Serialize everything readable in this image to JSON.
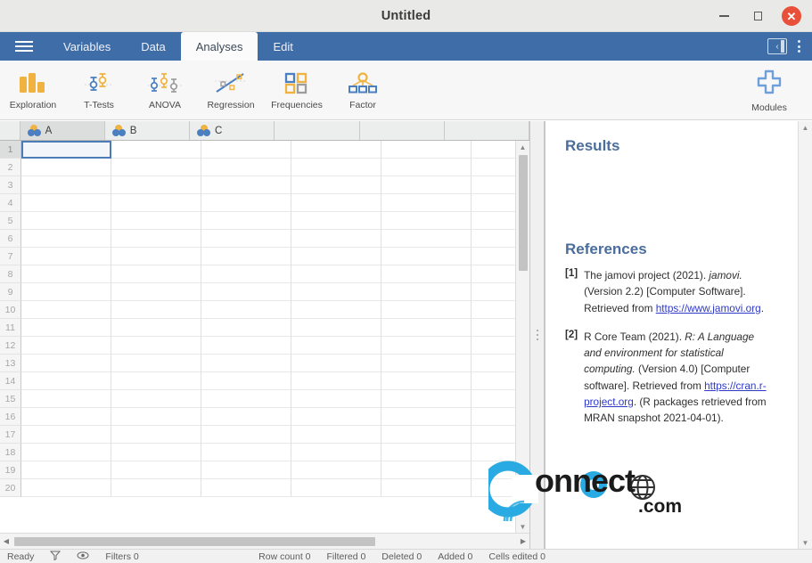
{
  "window": {
    "title": "Untitled",
    "minimize_label": "Minimize",
    "maximize_label": "Maximize",
    "close_label": "Close"
  },
  "ribbon": {
    "menu_label": "Menu",
    "tabs": [
      {
        "label": "Variables",
        "active": false
      },
      {
        "label": "Data",
        "active": false
      },
      {
        "label": "Analyses",
        "active": true
      },
      {
        "label": "Edit",
        "active": false
      }
    ],
    "panel_toggle_label": "Toggle results panel",
    "overflow_label": "More options"
  },
  "toolbar": {
    "buttons": [
      {
        "label": "Exploration",
        "icon": "bar-chart-icon"
      },
      {
        "label": "T-Tests",
        "icon": "ttest-icon"
      },
      {
        "label": "ANOVA",
        "icon": "anova-icon"
      },
      {
        "label": "Regression",
        "icon": "scatter-regression-icon"
      },
      {
        "label": "Frequencies",
        "icon": "grid-squares-icon"
      },
      {
        "label": "Factor",
        "icon": "factor-tree-icon"
      }
    ],
    "modules": {
      "label": "Modules",
      "icon": "plus-icon"
    }
  },
  "spreadsheet": {
    "columns": [
      {
        "name": "A",
        "type_icon": "nominal-icon",
        "selected": true
      },
      {
        "name": "B",
        "type_icon": "nominal-icon",
        "selected": false
      },
      {
        "name": "C",
        "type_icon": "nominal-icon",
        "selected": false
      },
      {
        "name": "",
        "type_icon": "",
        "selected": false
      },
      {
        "name": "",
        "type_icon": "",
        "selected": false
      },
      {
        "name": "",
        "type_icon": "",
        "selected": false
      }
    ],
    "rows": [
      1,
      2,
      3,
      4,
      5,
      6,
      7,
      8,
      9,
      10,
      11,
      12,
      13,
      14,
      15,
      16,
      17,
      18,
      19,
      20
    ],
    "active_cell": {
      "row": 1,
      "column": "A"
    }
  },
  "results": {
    "heading": "Results",
    "references_heading": "References",
    "references": [
      {
        "marker": "[1]",
        "parts": [
          {
            "text": "The jamovi project (2021). ",
            "style": "normal"
          },
          {
            "text": "jamovi.",
            "style": "italic"
          },
          {
            "text": " (Version 2.2) [Computer Software]. Retrieved from ",
            "style": "normal"
          },
          {
            "text": "https://www.jamovi.org",
            "style": "link"
          },
          {
            "text": ".",
            "style": "normal"
          }
        ]
      },
      {
        "marker": "[2]",
        "parts": [
          {
            "text": "R Core Team (2021). ",
            "style": "normal"
          },
          {
            "text": "R: A Language and environment for statistical computing.",
            "style": "italic"
          },
          {
            "text": " (Version 4.0) [Computer software]. Retrieved from ",
            "style": "normal"
          },
          {
            "text": "https://cran.r-project.org",
            "style": "link"
          },
          {
            "text": ". (R packages retrieved from MRAN snapshot 2021-04-01).",
            "style": "normal"
          }
        ]
      }
    ]
  },
  "statusbar": {
    "ready": "Ready",
    "filter_icon": "funnel-icon",
    "visibility_icon": "eye-icon",
    "filters": "Filters 0",
    "row_count": "Row count 0",
    "filtered": "Filtered 0",
    "deleted": "Deleted 0",
    "added": "Added 0",
    "cells_edited": "Cells edited 0"
  },
  "watermark": {
    "text": "onnect",
    "suffix": ".com",
    "logo_icon": "connect-c-logo-icon",
    "globe_icon": "globe-icon"
  },
  "colors": {
    "ribbon_blue": "#3e6da8",
    "heading_blue": "#4a6d9c",
    "icon_orange": "#f0b342",
    "icon_blue": "#4a7fc1",
    "close_red": "#e8503a",
    "link_blue": "#2f39c8",
    "watermark_blue": "#2aaae2"
  }
}
